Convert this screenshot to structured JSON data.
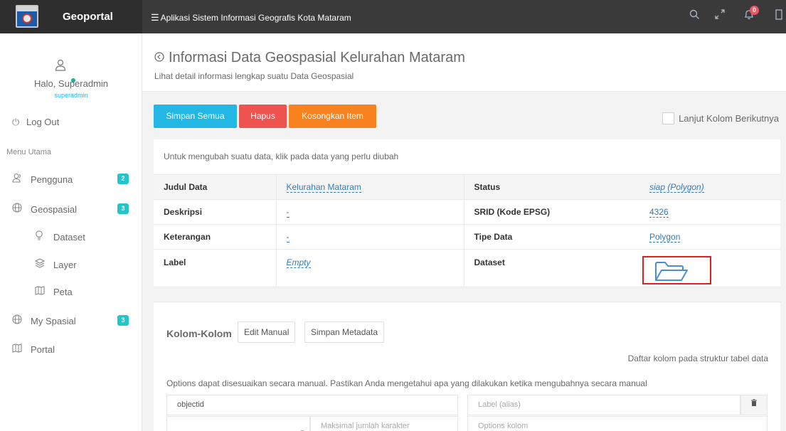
{
  "brand": {
    "name": "Geoportal"
  },
  "topbar": {
    "title": "Aplikasi Sistem Informasi Geografis Kota Mataram",
    "notifications_count": "0",
    "icons": [
      "menu-icon",
      "search-icon",
      "expand-icon",
      "bell-icon",
      "sidebar-toggle-icon"
    ]
  },
  "sidebar": {
    "greeting": "Halo, Superadmin",
    "username": "superadmin",
    "logout": "Log Out",
    "menu_heading": "Menu Utama",
    "items": [
      {
        "label": "Pengguna",
        "icon": "users-icon",
        "count": "2"
      },
      {
        "label": "Geospasial",
        "icon": "globe-icon",
        "count": "3"
      },
      {
        "label": "Dataset",
        "icon": "bulb-icon"
      },
      {
        "label": "Layer",
        "icon": "layers-icon"
      },
      {
        "label": "Peta",
        "icon": "map-icon"
      },
      {
        "label": "My Spasial",
        "icon": "globe-icon",
        "count": "3"
      },
      {
        "label": "Portal",
        "icon": "map-icon"
      }
    ],
    "status_color": "#1ab394"
  },
  "page": {
    "title": "Informasi Data Geospasial Kelurahan Mataram",
    "subtitle": "Lihat detail informasi lengkap suatu Data Geospasial"
  },
  "actions": {
    "save_all": "Simpan Semua",
    "delete": "Hapus",
    "clear": "Kosongkan Item",
    "next_column": "Lanjut Kolom Berikutnya"
  },
  "details": {
    "hint": "Untuk mengubah suatu data, klik pada data yang perlu diubah",
    "rows": [
      {
        "k1": "Judul Data",
        "v1": "Kelurahan Mataram",
        "k2": "Status",
        "v2": "siap (Polygon)"
      },
      {
        "k1": "Deskripsi",
        "v1": "-",
        "k2": "SRID (Kode EPSG)",
        "v2": "4326"
      },
      {
        "k1": "Keterangan",
        "v1": "-",
        "k2": "Tipe Data",
        "v2": "Polygon"
      },
      {
        "k1": "Label",
        "v1": "Empty",
        "k2": "Dataset",
        "v2_icon": "folder-open-icon"
      }
    ]
  },
  "columns": {
    "heading": "Kolom-Kolom",
    "edit_manual": "Edit Manual",
    "save_metadata": "Simpan Metadata",
    "right_note": "Daftar kolom pada struktur tabel data",
    "note": "Options dapat disesuaikan secara manual. Pastikan Anda mengetahui apa yang dilakukan ketika mengubahnya secara manual",
    "row": {
      "name_value": "objectid",
      "label_placeholder": "Label (alias)",
      "maxlen_placeholder": "Maksimal jumlah karakter",
      "options_placeholder": "Options kolom"
    }
  },
  "colors": {
    "primary": "#23b7e5",
    "danger": "#ef5350",
    "warning": "#f8821f",
    "badge": "#23c6c8",
    "highlight": "#e01f1f"
  }
}
